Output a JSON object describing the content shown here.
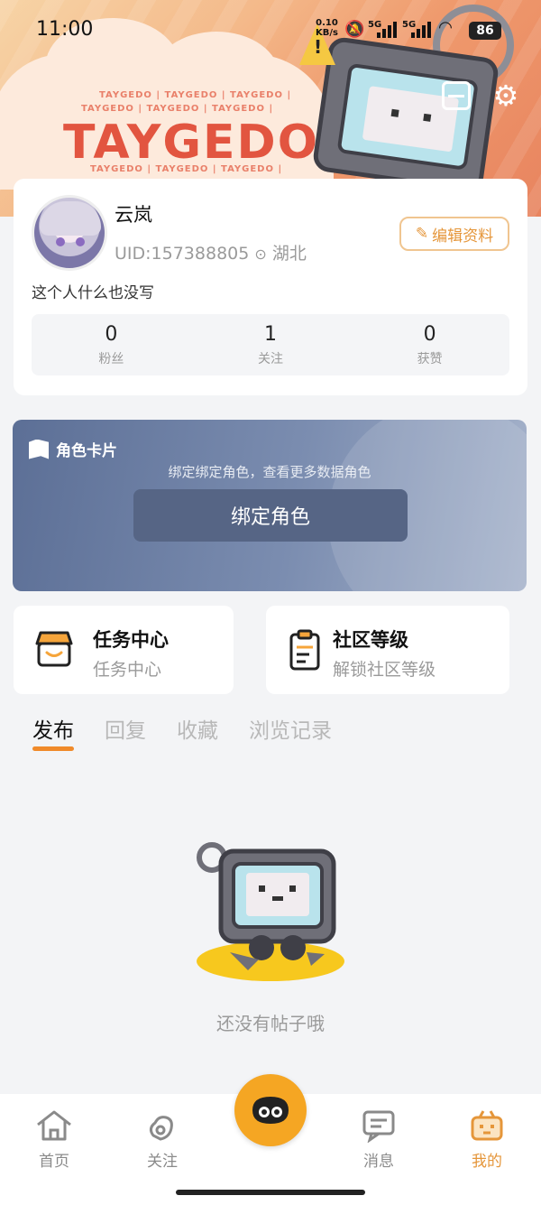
{
  "status_bar": {
    "time": "11:00",
    "net_speed": "0.10",
    "net_unit": "KB/s",
    "sim1": "5G",
    "sim2": "5G",
    "battery": "86"
  },
  "header": {
    "brand": "TAYGEDO",
    "brand_repeat": "TAYGEDO | TAYGEDO | TAYGEDO |"
  },
  "profile": {
    "name": "云岚",
    "uid": "UID:157388805",
    "location": "湖北",
    "edit_label": "编辑资料",
    "bio": "这个人什么也没写",
    "stats": [
      {
        "value": "0",
        "label": "粉丝"
      },
      {
        "value": "1",
        "label": "关注"
      },
      {
        "value": "0",
        "label": "获赞"
      }
    ]
  },
  "role_card": {
    "title": "角色卡片",
    "subtitle": "绑定绑定角色，查看更多数据角色",
    "button": "绑定角色"
  },
  "cards": [
    {
      "title": "任务中心",
      "subtitle": "任务中心",
      "icon": "shop-icon"
    },
    {
      "title": "社区等级",
      "subtitle": "解锁社区等级",
      "icon": "clipboard-icon"
    }
  ],
  "tabs": [
    "发布",
    "回复",
    "收藏",
    "浏览记录"
  ],
  "empty_text": "还没有帖子哦",
  "nav": [
    {
      "label": "首页",
      "icon": "home-icon"
    },
    {
      "label": "关注",
      "icon": "follow-icon"
    },
    {
      "label": "消息",
      "icon": "message-icon"
    },
    {
      "label": "我的",
      "icon": "profile-icon"
    }
  ],
  "colors": {
    "accent": "#e5963a",
    "tab_underline": "#f08a2a",
    "role_card": "#5c6f96"
  }
}
